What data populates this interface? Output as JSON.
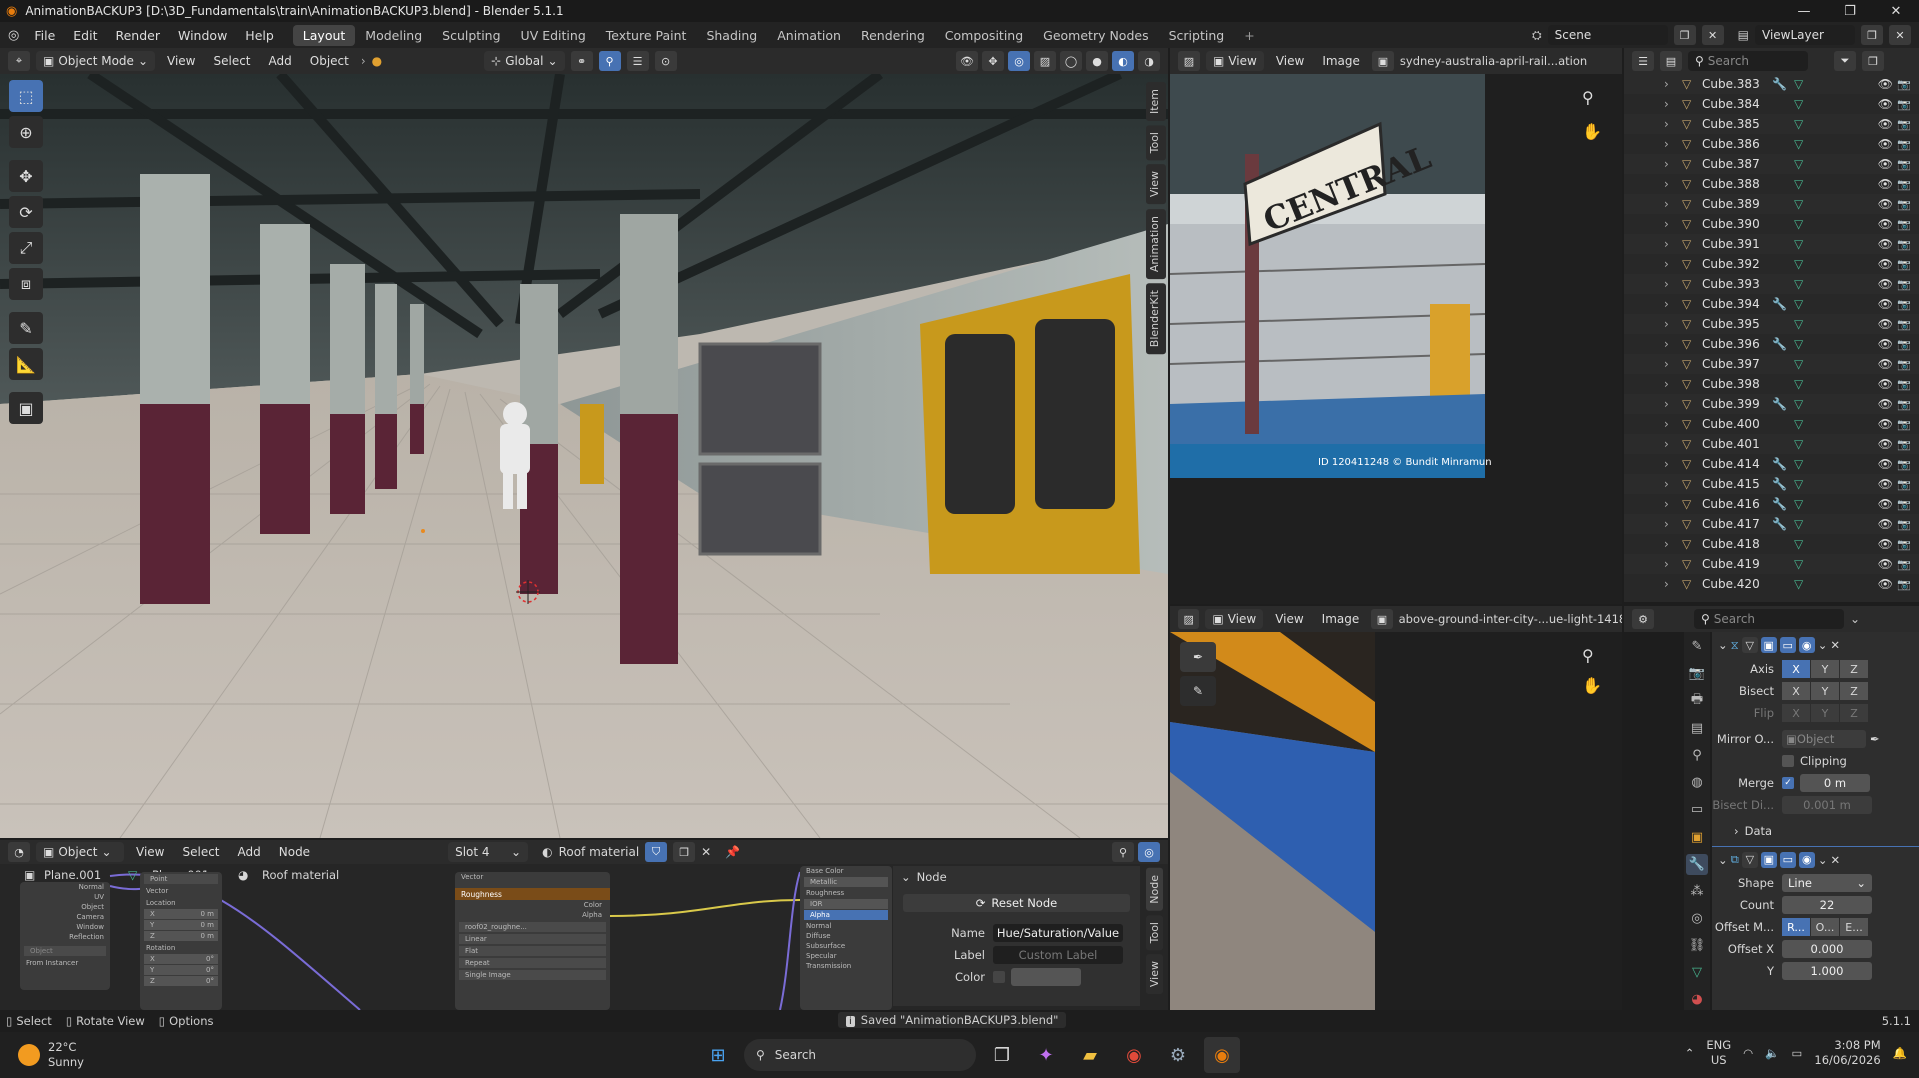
{
  "window": {
    "title": "AnimationBACKUP3 [D:\\3D_Fundamentals\\train\\AnimationBACKUP3.blend] - Blender 5.1.1",
    "controls": [
      "—",
      "❐",
      "✕"
    ]
  },
  "menus": [
    "File",
    "Edit",
    "Render",
    "Window",
    "Help"
  ],
  "workspaces": [
    "Layout",
    "Modeling",
    "Sculpting",
    "UV Editing",
    "Texture Paint",
    "Shading",
    "Animation",
    "Rendering",
    "Compositing",
    "Geometry Nodes",
    "Scripting"
  ],
  "active_workspace": "Layout",
  "scene": {
    "scene_name": "Scene",
    "view_layer": "ViewLayer"
  },
  "viewport": {
    "mode": "Object Mode",
    "menus": [
      "View",
      "Select",
      "Add",
      "Object"
    ],
    "orientation": "Global",
    "npanel_tabs": [
      "Item",
      "Tool",
      "View",
      "Animation",
      "BlenderKit"
    ],
    "tools": [
      "select-box",
      "cursor",
      "move",
      "rotate",
      "scale",
      "transform",
      "annotate",
      "measure",
      "add-cube"
    ]
  },
  "image_editor_top": {
    "menus": [
      "View",
      "View",
      "Image"
    ],
    "image_name": "sydney-australia-april-rail...ation",
    "sign_text": "CENTRAL",
    "watermark": "ID 120411248 © Bundit Minramun"
  },
  "image_editor_bottom": {
    "menus": [
      "View",
      "View",
      "Image"
    ],
    "image_name": "above-ground-inter-city-...ue-light-141824"
  },
  "outliner": {
    "search_placeholder": "Search",
    "items": [
      {
        "name": "Cube.383",
        "mod": true
      },
      {
        "name": "Cube.384",
        "mod": false
      },
      {
        "name": "Cube.385",
        "mod": false
      },
      {
        "name": "Cube.386",
        "mod": false
      },
      {
        "name": "Cube.387",
        "mod": false
      },
      {
        "name": "Cube.388",
        "mod": false
      },
      {
        "name": "Cube.389",
        "mod": false
      },
      {
        "name": "Cube.390",
        "mod": false
      },
      {
        "name": "Cube.391",
        "mod": false
      },
      {
        "name": "Cube.392",
        "mod": false
      },
      {
        "name": "Cube.393",
        "mod": false
      },
      {
        "name": "Cube.394",
        "mod": true
      },
      {
        "name": "Cube.395",
        "mod": false
      },
      {
        "name": "Cube.396",
        "mod": true
      },
      {
        "name": "Cube.397",
        "mod": false
      },
      {
        "name": "Cube.398",
        "mod": false
      },
      {
        "name": "Cube.399",
        "mod": true
      },
      {
        "name": "Cube.400",
        "mod": false
      },
      {
        "name": "Cube.401",
        "mod": false
      },
      {
        "name": "Cube.414",
        "mod": true
      },
      {
        "name": "Cube.415",
        "mod": true
      },
      {
        "name": "Cube.416",
        "mod": true
      },
      {
        "name": "Cube.417",
        "mod": true
      },
      {
        "name": "Cube.418",
        "mod": false
      },
      {
        "name": "Cube.419",
        "mod": false
      },
      {
        "name": "Cube.420",
        "mod": false
      }
    ]
  },
  "properties": {
    "search_placeholder": "Search",
    "mirror": {
      "axis_label": "Axis",
      "bisect_label": "Bisect",
      "flip_label": "Flip",
      "axes": [
        "X",
        "Y",
        "Z"
      ],
      "mirror_object_label": "Mirror O...",
      "mirror_object_placeholder": "Object",
      "clipping_label": "Clipping",
      "merge_label": "Merge",
      "merge_value": "0 m",
      "bisect_distance_label": "Bisect Di...",
      "bisect_distance_value": "0.001 m",
      "data_label": "Data"
    },
    "array": {
      "shape_label": "Shape",
      "shape_value": "Line",
      "count_label": "Count",
      "count_value": "22",
      "offset_mode_label": "Offset M...",
      "offset_modes": [
        "R...",
        "O...",
        "E..."
      ],
      "offset_x_label": "Offset X",
      "offset_x_value": "0.000",
      "offset_y_label": "Y",
      "offset_y_value": "1.000"
    }
  },
  "node_editor": {
    "type_label": "Object",
    "menus": [
      "View",
      "Select",
      "Add",
      "Node"
    ],
    "slot": "Slot 4",
    "material": "Roof material",
    "breadcrumbs": [
      "Plane.001",
      "Plane.001",
      "Roof material"
    ],
    "texcoord_outputs": [
      "Normal",
      "UV",
      "Object",
      "Camera",
      "Window",
      "Reflection"
    ],
    "texcoord_object_placeholder": "Object",
    "from_instancer": "From Instancer",
    "mapping": {
      "type_label": "Point",
      "vector_label": "Vector",
      "location_label": "Location",
      "rotation_label": "Rotation",
      "location": [
        "0 m",
        "0 m",
        "0 m"
      ],
      "rotation": [
        "0°",
        "0°",
        "0°"
      ],
      "axes": [
        "X",
        "Y",
        "Z"
      ]
    },
    "roughness_node": {
      "title": "Roughness",
      "vector_label": "Vector",
      "color_out": "Color",
      "alpha_out": "Alpha",
      "image_name": "roof02_roughne...",
      "interpolation": "Linear",
      "projection": "Flat",
      "extension": "Repeat",
      "source": "Single Image"
    },
    "bsdf_inputs": [
      "Base Color",
      "Metallic",
      "Roughness",
      "IOR",
      "Alpha",
      "Normal"
    ],
    "bsdf_panels": [
      "Diffuse",
      "Subsurface",
      "Specular",
      "Transmission"
    ],
    "side_tabs": [
      "Node",
      "Tool",
      "View"
    ],
    "node_panel": {
      "header": "Node",
      "reset_button": "Reset Node",
      "name_label": "Name",
      "name_value": "Hue/Saturation/Value",
      "label_label": "Label",
      "label_placeholder": "Custom Label",
      "color_label": "Color"
    }
  },
  "statusbar": {
    "select": "Select",
    "rotate": "Rotate View",
    "options": "Options",
    "message": "Saved \"AnimationBACKUP3.blend\"",
    "version": "5.1.1"
  },
  "taskbar": {
    "weather_temp": "22°C",
    "weather_desc": "Sunny",
    "search": "Search",
    "lang1": "ENG",
    "lang2": "US",
    "time": "3:08 PM",
    "date": "16/06/2026"
  }
}
